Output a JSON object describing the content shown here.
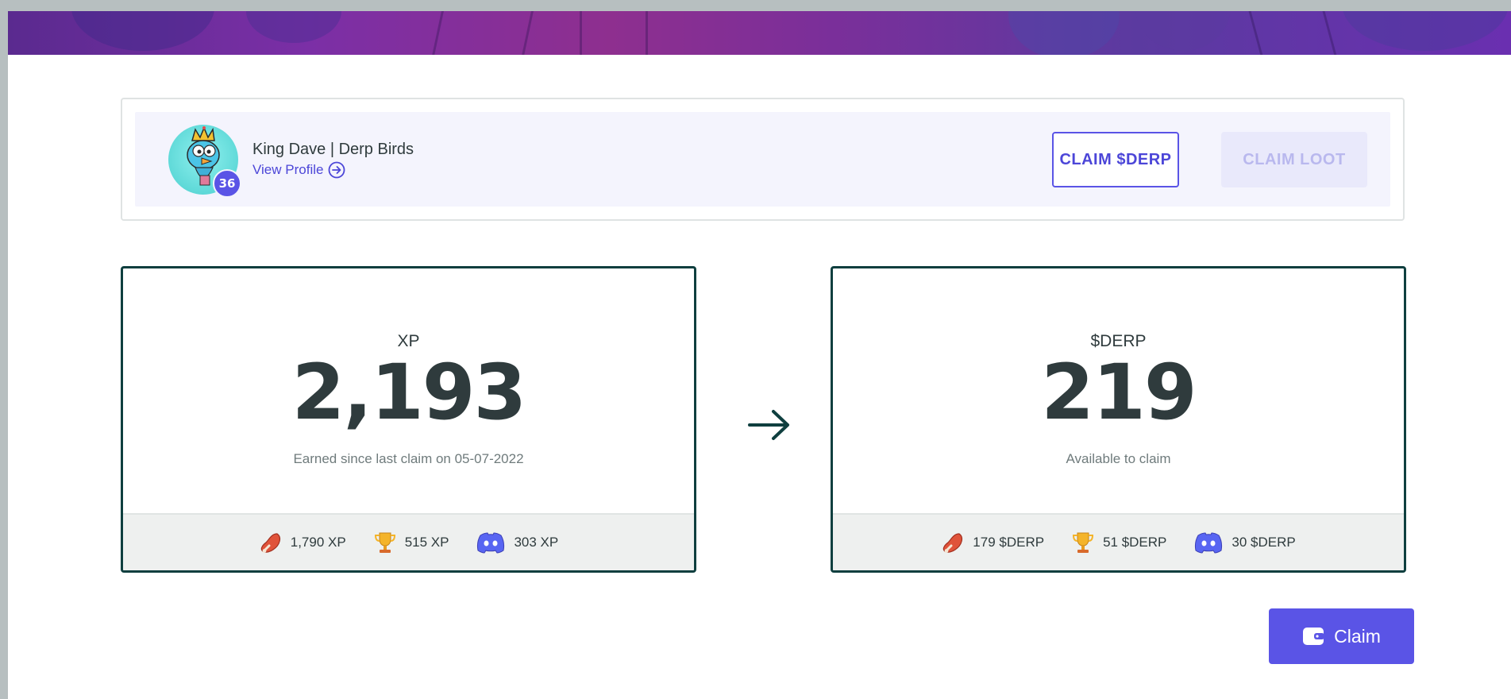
{
  "profile": {
    "name": "King Dave | Derp Birds",
    "view_profile_label": "View Profile",
    "level": "36"
  },
  "actions": {
    "claim_derp_label": "CLAIM $DERP",
    "claim_loot_label": "CLAIM LOOT",
    "claim_label": "Claim"
  },
  "xp_card": {
    "label": "XP",
    "value": "2,193",
    "subtitle": "Earned since last claim on 05-07-2022",
    "breakdown": [
      {
        "icon": "meat-icon",
        "text": "1,790 XP"
      },
      {
        "icon": "trophy-icon",
        "text": "515 XP"
      },
      {
        "icon": "discord-icon",
        "text": "303 XP"
      }
    ]
  },
  "derp_card": {
    "label": "$DERP",
    "value": "219",
    "subtitle": "Available to claim",
    "breakdown": [
      {
        "icon": "meat-icon",
        "text": "179 $DERP"
      },
      {
        "icon": "trophy-icon",
        "text": "51 $DERP"
      },
      {
        "icon": "discord-icon",
        "text": "30 $DERP"
      }
    ]
  },
  "colors": {
    "accent": "#5a54e6",
    "card_border": "#0f3f3f",
    "text": "#2f3b3d"
  }
}
